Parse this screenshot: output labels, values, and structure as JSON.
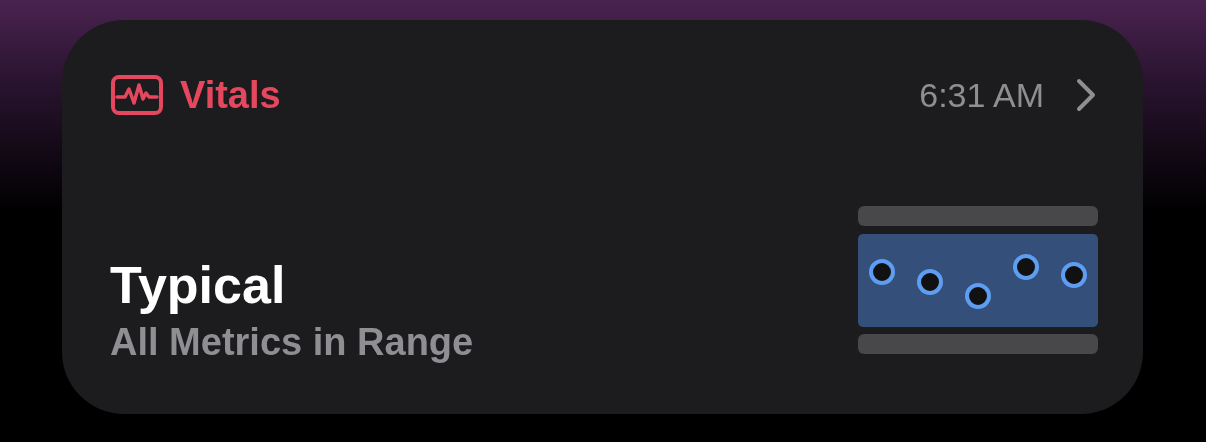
{
  "widget": {
    "title": "Vitals",
    "time": "6:31 AM",
    "status": "Typical",
    "detail": "All Metrics in Range"
  }
}
